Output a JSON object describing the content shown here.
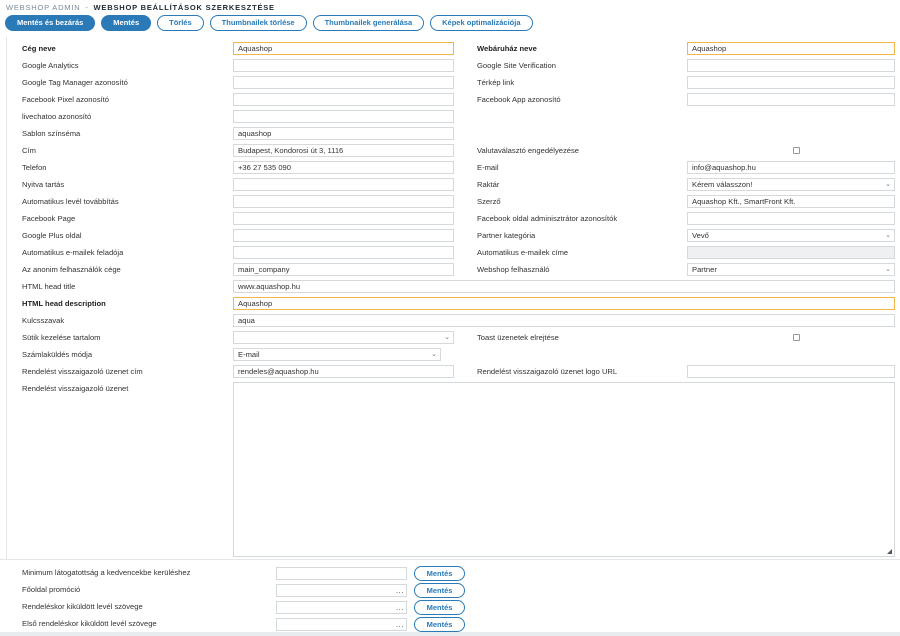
{
  "breadcrumb": {
    "root": "WEBSHOP ADMIN",
    "separator": "-",
    "current": "WEBSHOP BEÁLLÍTÁSOK SZERKESZTÉSE"
  },
  "toolbar": {
    "save_close": "Mentés és bezárás",
    "save": "Mentés",
    "delete": "Törlés",
    "delete_thumbs": "Thumbnailek törlése",
    "gen_thumbs": "Thumbnailek generálása",
    "optimize_images": "Képek optimalizációja"
  },
  "form": {
    "company_name": {
      "label": "Cég neve",
      "value": "Aquashop"
    },
    "webshop_name": {
      "label": "Webáruház neve",
      "value": "Aquashop"
    },
    "google_analytics": {
      "label": "Google Analytics",
      "value": ""
    },
    "google_site_verification": {
      "label": "Google Site Verification",
      "value": ""
    },
    "gtm_id": {
      "label": "Google Tag Manager azonosító",
      "value": ""
    },
    "map_link": {
      "label": "Térkép link",
      "value": ""
    },
    "fb_pixel": {
      "label": "Facebook Pixel azonosító",
      "value": ""
    },
    "fb_app": {
      "label": "Facebook App azonosító",
      "value": ""
    },
    "livechatoo": {
      "label": "livechatoo azonosító",
      "value": ""
    },
    "template_color": {
      "label": "Sablon színséma",
      "value": "aquashop"
    },
    "address": {
      "label": "Cím",
      "value": "Budapest, Kondorosi út 3, 1116"
    },
    "currency_switcher": {
      "label": "Valutaválasztó engedélyezése"
    },
    "phone": {
      "label": "Telefon",
      "value": "+36 27 535 090"
    },
    "email": {
      "label": "E-mail",
      "value": "info@aquashop.hu"
    },
    "opening_hours": {
      "label": "Nyitva tartás",
      "value": ""
    },
    "warehouse": {
      "label": "Raktár",
      "value": "Kérem válasszon!"
    },
    "auto_forward": {
      "label": "Automatikus levél továbbítás",
      "value": ""
    },
    "author": {
      "label": "Szerző",
      "value": "Aquashop Kft., SmartFront Kft."
    },
    "fb_page": {
      "label": "Facebook Page",
      "value": ""
    },
    "fb_admin_ids": {
      "label": "Facebook oldal adminisztrátor azonosítók",
      "value": ""
    },
    "gplus": {
      "label": "Google Plus oldal",
      "value": ""
    },
    "partner_category": {
      "label": "Partner kategória",
      "value": "Vevő"
    },
    "auto_email_sender": {
      "label": "Automatikus e-mailek feladója",
      "value": ""
    },
    "auto_email_address": {
      "label": "Automatikus e-mailek címe",
      "value": ""
    },
    "anon_company": {
      "label": "Az anonim felhasználók cége",
      "value": "main_company"
    },
    "webshop_user": {
      "label": "Webshop felhasználó",
      "value": "Partner"
    },
    "html_title": {
      "label": "HTML head title",
      "value": "www.aquashop.hu"
    },
    "html_desc": {
      "label": "HTML head description",
      "value": "Aquashop"
    },
    "keywords": {
      "label": "Kulcsszavak",
      "value": "aqua"
    },
    "cookie_content": {
      "label": "Sütik kezelése tartalom",
      "value": ""
    },
    "toast_hide": {
      "label": "Toast üzenetek elrejtése"
    },
    "invoice_mode": {
      "label": "Számlaküldés módja",
      "value": "E-mail"
    },
    "order_confirm_addr": {
      "label": "Rendelést visszaigazoló üzenet cím",
      "value": "rendeles@aquashop.hu"
    },
    "order_confirm_logo": {
      "label": "Rendelést visszaigazoló üzenet logo URL",
      "value": ""
    },
    "order_confirm_msg": {
      "label": "Rendelést visszaigazoló üzenet"
    }
  },
  "footer": {
    "rows": [
      {
        "label": "Minimum látogatottság a kedvencekbe kerüléshez",
        "button": "Mentés",
        "dots": ""
      },
      {
        "label": "Főoldal promóció",
        "button": "Mentés",
        "dots": "..."
      },
      {
        "label": "Rendeléskor kiküldött levél szövege",
        "button": "Mentés",
        "dots": "..."
      },
      {
        "label": "Első rendeléskor kiküldött levél szövege",
        "button": "Mentés",
        "dots": "..."
      }
    ]
  },
  "icons": {
    "dropdown": "chevron-down-icon",
    "resize": "resize-grip-icon"
  }
}
